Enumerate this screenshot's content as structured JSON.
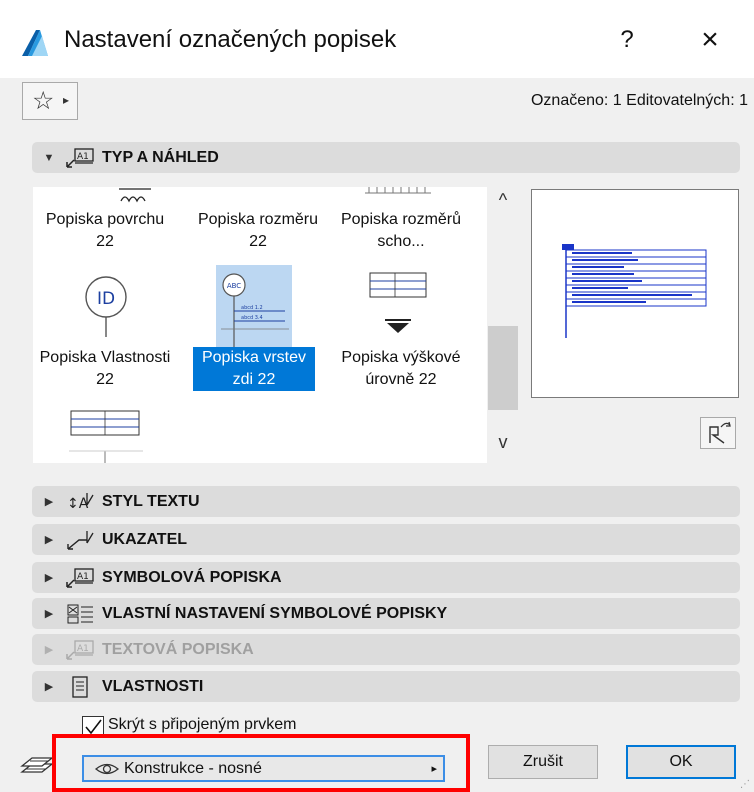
{
  "window": {
    "title": "Nastavení označených popisek",
    "help": "?",
    "close": "×"
  },
  "toolbar": {
    "star_glyph": "☆",
    "star_arrow": "▸",
    "selection_count": "Označeno: 1 Editovatelných: 1"
  },
  "sections": {
    "typ_a_nahled": "TYP A NÁHLED",
    "styl_textu": "STYL TEXTU",
    "ukazatel": "UKAZATEL",
    "symbolova_popiska": "SYMBOLOVÁ POPISKA",
    "vlastni_nastaveni": "VLASTNÍ NASTAVENÍ SYMBOLOVÉ POPISKY",
    "textova_popiska": "TEXTOVÁ POPISKA",
    "vlastnosti": "VLASTNOSTI"
  },
  "gallery": {
    "items": [
      {
        "label": "Popiska povrchu 22"
      },
      {
        "label": "Popiska rozměru 22"
      },
      {
        "label": "Popiska rozměrů scho..."
      },
      {
        "label": "Popiska Vlastnosti 22"
      },
      {
        "label": "Popiska vrstev zdi 22",
        "selected": true
      },
      {
        "label": "Popiska výškové úrovně 22"
      }
    ],
    "id_glyph": "ID",
    "abc_glyph": "ABC",
    "scroll_up": "^",
    "scroll_down": "v"
  },
  "options": {
    "hide_with_element": "Skrýt s připojeným prvkem",
    "hide_checked": true
  },
  "footer": {
    "layer_value": "Konstrukce - nosné",
    "layer_arrow": "▸",
    "cancel_label": "Zrušit",
    "ok_label": "OK"
  },
  "colors": {
    "accent": "#0078d7",
    "highlight": "#ff0000",
    "preview_blue": "#1a35c8"
  }
}
